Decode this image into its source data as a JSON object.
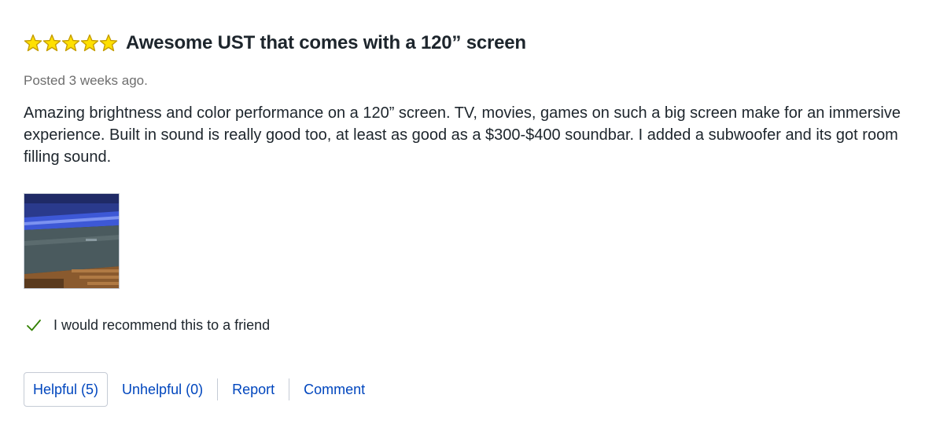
{
  "review": {
    "rating": 5,
    "rating_max": 5,
    "star_icon": "star-icon",
    "star_color": "#ffe000",
    "star_outline_color": "#c59d00",
    "title": "Awesome UST that comes with a 120” screen",
    "posted": "Posted 3 weeks ago.",
    "body": "Amazing brightness and color performance on a 120” screen. TV, movies, games on such a big screen make for an immersive experience. Built in sound is really good too, at least as good as a $300-$400 soundbar. I added a subwoofer and its got room filling sound.",
    "recommend": {
      "icon": "check-icon",
      "color": "#318000",
      "label": "I would recommend this to a friend"
    },
    "actions": {
      "helpful_label": "Helpful (5)",
      "unhelpful_label": "Unhelpful (0)",
      "report_label": "Report",
      "comment_label": "Comment",
      "link_color": "#0046be"
    }
  }
}
